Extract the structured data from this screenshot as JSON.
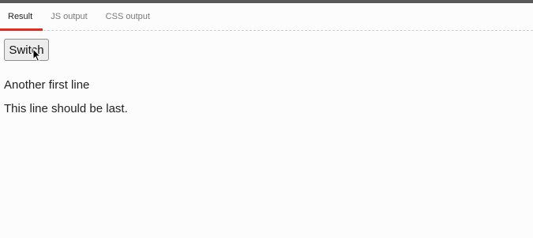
{
  "tabs": [
    {
      "label": "Result",
      "active": true
    },
    {
      "label": "JS output",
      "active": false
    },
    {
      "label": "CSS output",
      "active": false
    }
  ],
  "result": {
    "button_label": "Switch",
    "lines": [
      "Another first line",
      "This line should be last."
    ]
  },
  "colors": {
    "active_tab_underline": "#e22b1d",
    "top_bar": "#5a5a5a"
  }
}
